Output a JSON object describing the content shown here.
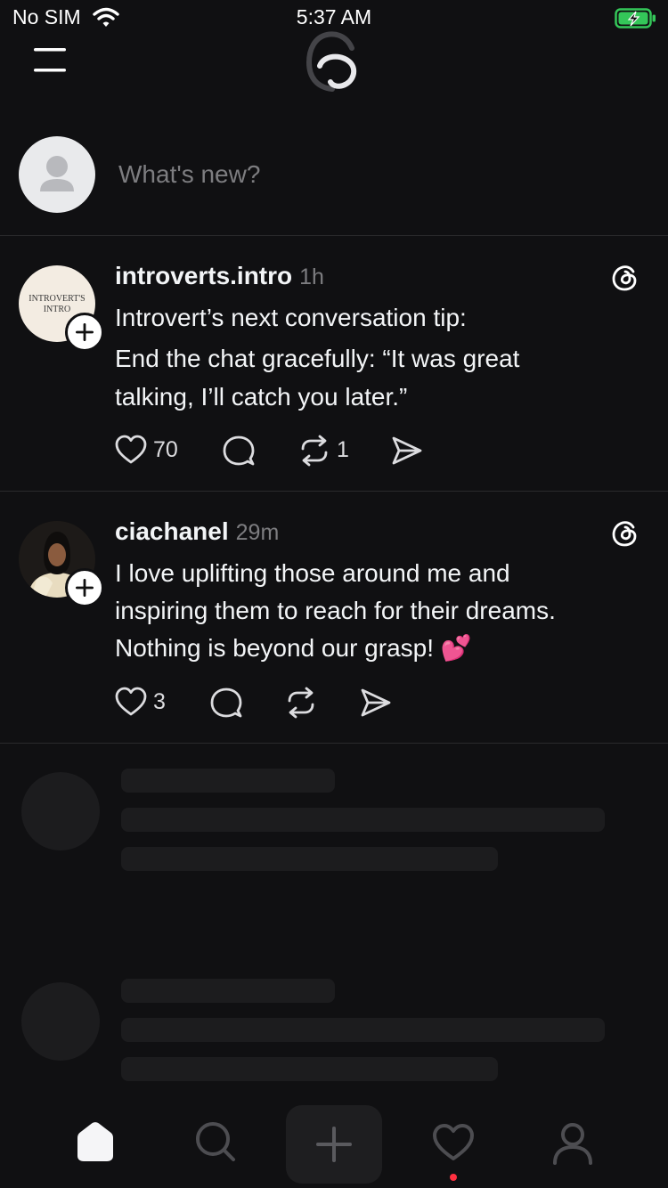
{
  "status": {
    "carrier": "No SIM",
    "time": "5:37 AM",
    "battery_color": "#34c759"
  },
  "composer": {
    "placeholder": "What's new?"
  },
  "posts": [
    {
      "username": "introverts.intro",
      "time": "1h",
      "avatar_text": "INTROVERT'S INTRO",
      "lines": [
        "Introvert’s next conversation tip:",
        "End the chat gracefully: “It was great",
        "talking, I’ll catch you later.”"
      ],
      "likes": "70",
      "reposts": "1"
    },
    {
      "username": "ciachanel",
      "time": "29m",
      "lines": [
        "I love uplifting those around me and",
        "inspiring them to reach for their dreams.",
        "Nothing is beyond our grasp! 💕"
      ],
      "likes": "3"
    }
  ],
  "tabs": [
    "home-icon",
    "search-icon",
    "create-icon",
    "activity-icon",
    "profile-icon"
  ],
  "colors": {
    "background": "#101012",
    "text": "#f3f5f7",
    "muted": "#7d7d80",
    "notification": "#ff3040"
  }
}
